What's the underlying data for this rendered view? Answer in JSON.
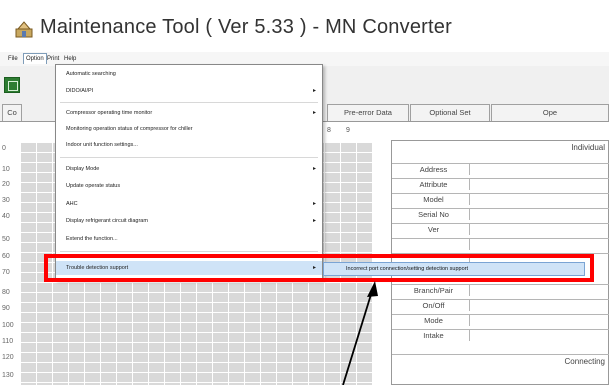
{
  "window": {
    "title": "Maintenance Tool ( Ver 5.33 ) - MN Converter",
    "icon": "app-icon"
  },
  "menubar": {
    "items": [
      "File",
      "Option",
      "Print",
      "Help"
    ]
  },
  "toolbar": {
    "icon": "green-tool-icon"
  },
  "tabs": {
    "items": [
      "Co",
      "Pre-error Data",
      "Optional Set",
      "Ope"
    ]
  },
  "grid": {
    "col_headers": [
      "8",
      "9"
    ],
    "row_numbers": [
      "0",
      "10",
      "20",
      "30",
      "40",
      "50",
      "60",
      "70",
      "80",
      "90",
      "100",
      "110",
      "120",
      "130"
    ]
  },
  "info_panel": {
    "title": "Individual",
    "rows": [
      "Address",
      "Attribute",
      "Model",
      "Serial No",
      "Ver",
      "",
      "",
      "Branch/Pair",
      "On/Off",
      "Mode",
      "Intake"
    ],
    "footer": "Connecting"
  },
  "option_menu": {
    "items": [
      {
        "label": "Automatic searching",
        "submenu": false
      },
      {
        "label": "DIDO/AI/PI",
        "submenu": true
      },
      {
        "label": "Compressor operating time monitor",
        "submenu": true
      },
      {
        "label": "Monitoring operation status of compressor for chiller",
        "submenu": false
      },
      {
        "label": "Indoor unit function settings...",
        "submenu": false
      },
      {
        "label": "Display Mode",
        "submenu": true
      },
      {
        "label": "Update operate status",
        "submenu": false
      },
      {
        "label": "AHC",
        "submenu": true
      },
      {
        "label": "Display refrigerant circuit diagram",
        "submenu": true
      },
      {
        "label": "Extend the function...",
        "submenu": false
      },
      {
        "label": "Trouble detection support",
        "submenu": true
      }
    ],
    "submenu_item": "Incorrect port connection/setting detection support"
  },
  "annotation": {
    "highlight_color": "#ff0000",
    "arrow_color": "#000000"
  }
}
